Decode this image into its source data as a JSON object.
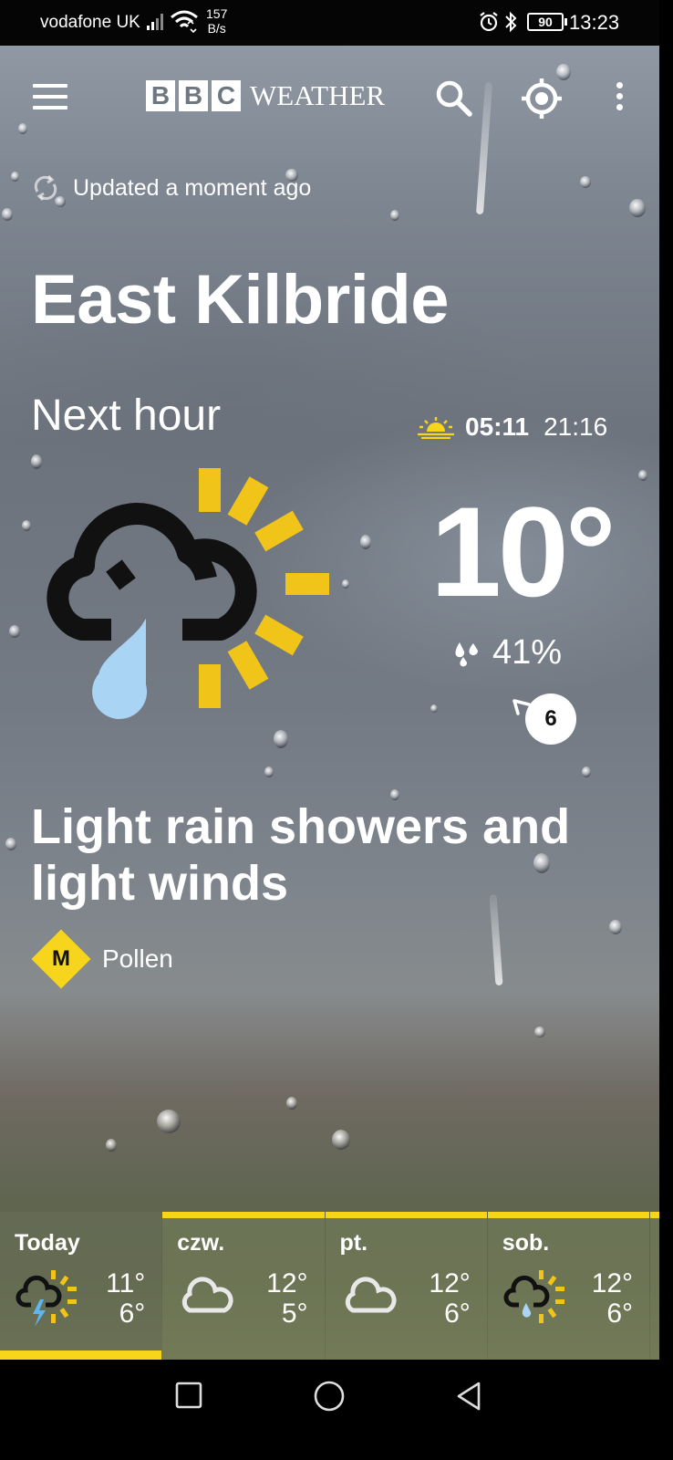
{
  "status_bar": {
    "carrier": "vodafone UK",
    "speed_value": "157",
    "speed_unit": "B/s",
    "battery": "90",
    "time": "13:23"
  },
  "header": {
    "logo_letters": [
      "B",
      "B",
      "C"
    ],
    "logo_word": "WEATHER",
    "icons": [
      "menu-icon",
      "search-icon",
      "locate-icon",
      "more-icon"
    ]
  },
  "update": {
    "text": "Updated a moment ago",
    "icon": "refresh-icon"
  },
  "location": "East Kilbride",
  "current": {
    "period_label": "Next hour",
    "sunrise": "05:11",
    "sunset": "21:16",
    "temperature": "10°",
    "precip_chance": "41%",
    "wind_speed": "6",
    "summary": "Light rain showers and light winds",
    "icon": "light-rain-sunny-intervals-icon"
  },
  "pollen": {
    "level": "M",
    "label": "Pollen"
  },
  "forecast": [
    {
      "day": "Today",
      "high": "11°",
      "low": "6°",
      "icon": "thunder-sunny-intervals-icon"
    },
    {
      "day": "czw.",
      "high": "12°",
      "low": "5°",
      "icon": "cloud-icon"
    },
    {
      "day": "pt.",
      "high": "12°",
      "low": "6°",
      "icon": "cloud-icon"
    },
    {
      "day": "sob.",
      "high": "12°",
      "low": "6°",
      "icon": "rain-sunny-intervals-icon"
    }
  ],
  "colors": {
    "accent": "#f7d51c",
    "rain": "#a9d4f4",
    "icon_dark": "#111111"
  }
}
